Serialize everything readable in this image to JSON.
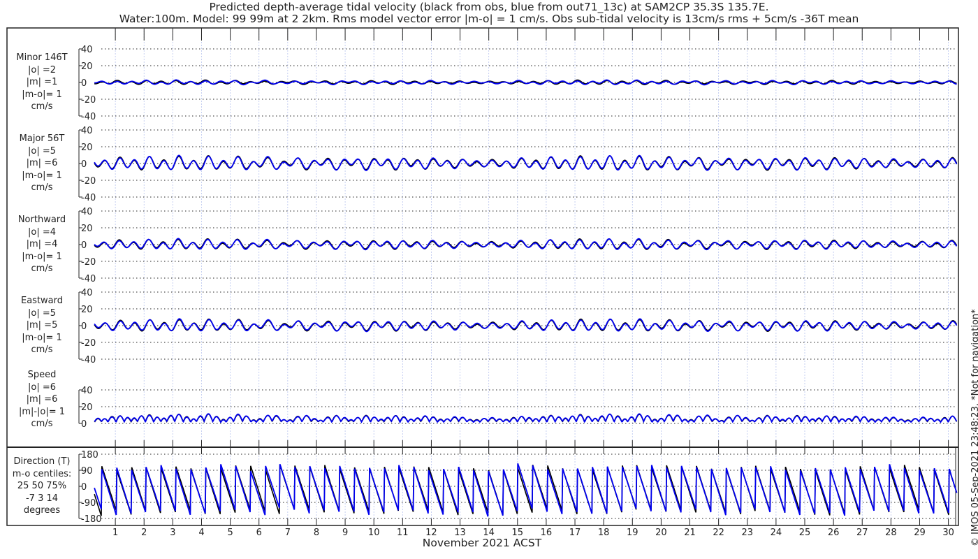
{
  "chart_data": {
    "type": "line",
    "title": "Predicted depth-average tidal velocity (black from obs, blue from out71_13c) at SAM2CP 35.3S 135.7E.",
    "subtitle": "Water:100m. Model: 99 99m at 2 2km. Rms model vector error |m-o| = 1 cm/s. Obs sub-tidal velocity is 13cm/s rms + 5cm/s -36T mean",
    "xlabel": "November 2021 ACST",
    "x_ticks": [
      "1",
      "2",
      "3",
      "4",
      "5",
      "6",
      "7",
      "8",
      "9",
      "10",
      "11",
      "12",
      "13",
      "14",
      "15",
      "16",
      "17",
      "18",
      "19",
      "20",
      "21",
      "22",
      "23",
      "24",
      "25",
      "26",
      "27",
      "28",
      "29",
      "30"
    ],
    "xlim_days": [
      0,
      30.3
    ],
    "legend": [
      {
        "name": "obs",
        "color": "#000000"
      },
      {
        "name": "model out71_13c",
        "color": "#0000ee"
      }
    ],
    "panels": [
      {
        "id": "minor",
        "label": [
          "Minor 146T",
          "|o| =2",
          "|m| =1",
          "|m-o|= 1",
          "cm/s"
        ],
        "ylim": [
          -40,
          40
        ],
        "yticks": [
          "40",
          "20",
          "0",
          "-20",
          "-40"
        ],
        "tick_values": [
          40,
          20,
          0,
          -20,
          -40
        ],
        "amplitude": 2.5,
        "phase": 1.2
      },
      {
        "id": "major",
        "label": [
          "Major 56T",
          "|o| =5",
          "|m| =6",
          "|m-o|= 1",
          "cm/s"
        ],
        "ylim": [
          -40,
          40
        ],
        "yticks": [
          "40",
          "20",
          "0",
          "-20",
          "-40"
        ],
        "tick_values": [
          40,
          20,
          0,
          -20,
          -40
        ],
        "amplitude": 9,
        "phase": 0
      },
      {
        "id": "north",
        "label": [
          "Northward",
          "|o| =4",
          "|m| =4",
          "|m-o|= 1",
          "cm/s"
        ],
        "ylim": [
          -40,
          40
        ],
        "yticks": [
          "40",
          "20",
          "0",
          "-20",
          "-40"
        ],
        "tick_values": [
          40,
          20,
          0,
          -20,
          -40
        ],
        "amplitude": 6.5,
        "phase": 0.3
      },
      {
        "id": "east",
        "label": [
          "Eastward",
          "|o| =5",
          "|m| =5",
          "|m-o|= 1",
          "cm/s"
        ],
        "ylim": [
          -40,
          40
        ],
        "yticks": [
          "40",
          "20",
          "0",
          "-20",
          "-40"
        ],
        "tick_values": [
          40,
          20,
          0,
          -20,
          -40
        ],
        "amplitude": 7.5,
        "phase": -0.2
      },
      {
        "id": "speed",
        "label": [
          "Speed",
          "|o| =6",
          "|m| =6",
          "|m|-|o|= 1",
          "cm/s"
        ],
        "ylim": [
          0,
          40
        ],
        "yticks": [
          "40",
          "20",
          "0"
        ],
        "tick_values": [
          40,
          20,
          0
        ],
        "amplitude": 9,
        "phase": 0
      },
      {
        "id": "direction",
        "label": [
          "Direction (T)",
          "m-o centiles:",
          "25  50  75%",
          "-7   3  14",
          "degrees"
        ],
        "ylim": [
          -180,
          180
        ],
        "yticks": [
          "180",
          "90",
          "0",
          "-90",
          "-180"
        ],
        "tick_values": [
          180,
          90,
          0,
          -90,
          -180
        ],
        "amplitude": 180,
        "phase": 0
      }
    ]
  },
  "footer": {
    "copyright": "© IMOS 05-Sep-2021 23:48:23. *Not for navigation*"
  }
}
